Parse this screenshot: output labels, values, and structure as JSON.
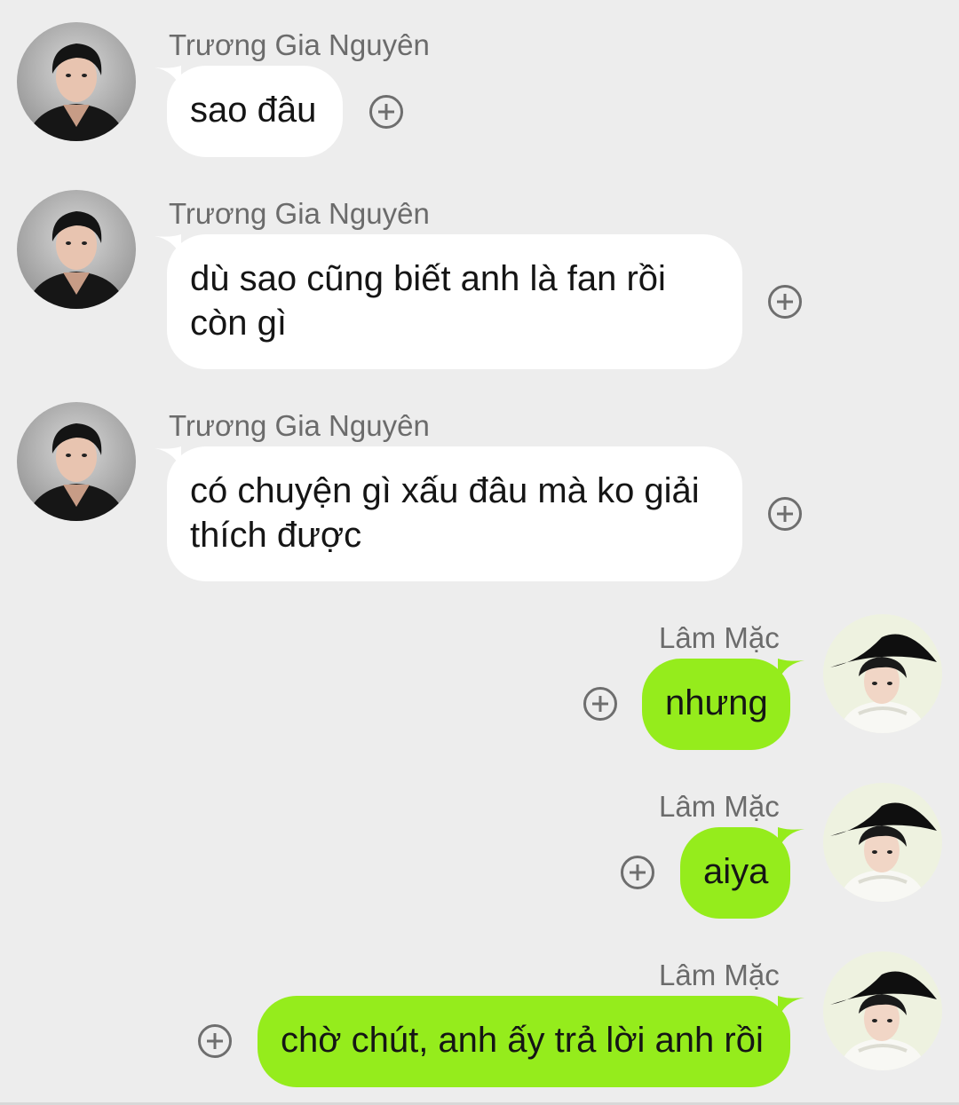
{
  "messages": [
    {
      "side": "in",
      "sender": "Trương Gia Nguyên",
      "text": "sao đâu",
      "avatar": "male-avatar-dark-shirt"
    },
    {
      "side": "in",
      "sender": "Trương Gia Nguyên",
      "text": "dù sao cũng biết anh là fan rồi còn gì",
      "avatar": "male-avatar-dark-shirt"
    },
    {
      "side": "in",
      "sender": "Trương Gia Nguyên",
      "text": "có chuyện gì xấu đâu mà ko giải thích được",
      "avatar": "male-avatar-dark-shirt"
    },
    {
      "side": "out",
      "sender": "Lâm Mặc",
      "text": "nhưng",
      "avatar": "male-avatar-black-hat"
    },
    {
      "side": "out",
      "sender": "Lâm Mặc",
      "text": "aiya",
      "avatar": "male-avatar-black-hat"
    },
    {
      "side": "out",
      "sender": "Lâm Mặc",
      "text": "chờ chút, anh ấy trả lời anh rồi",
      "avatar": "male-avatar-black-hat"
    }
  ],
  "icons": {
    "add": "plus-circle-icon"
  },
  "colors": {
    "background": "#ededed",
    "incoming_bubble": "#ffffff",
    "outgoing_bubble": "#95ec1c",
    "sender_name": "#6b6b6b"
  }
}
